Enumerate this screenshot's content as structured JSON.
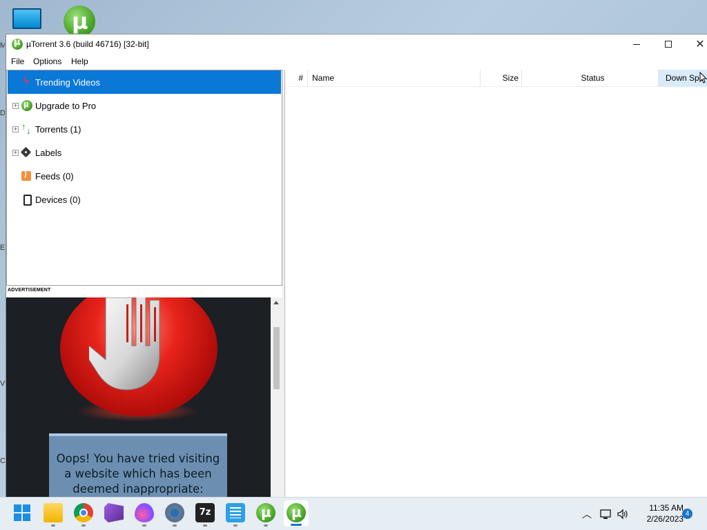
{
  "window": {
    "title": "µTorrent 3.6  (build 46716) [32-bit]",
    "controls": {
      "minimize": "",
      "maximize": "",
      "close": "✕"
    }
  },
  "menu": [
    "File",
    "Options",
    "Help"
  ],
  "sidebar": {
    "items": [
      {
        "label": "Trending Videos",
        "icon": "trending-icon",
        "expandable": false,
        "selected": true
      },
      {
        "label": "Upgrade to Pro",
        "icon": "utorrent-icon",
        "expandable": true,
        "selected": false
      },
      {
        "label": "Torrents (1)",
        "icon": "torrents-icon",
        "expandable": true,
        "selected": false
      },
      {
        "label": "Labels",
        "icon": "label-tag-icon",
        "expandable": true,
        "selected": false
      },
      {
        "label": "Feeds (0)",
        "icon": "rss-feed-icon",
        "expandable": false,
        "selected": false
      },
      {
        "label": "Devices (0)",
        "icon": "device-icon",
        "expandable": false,
        "selected": false
      }
    ],
    "selected_color": "#0a78d7"
  },
  "advertisement": {
    "label": "ADVERTISEMENT",
    "message_lines": [
      "Oops! You have tried visiting",
      "a website which has been",
      "deemed inappropriate:"
    ]
  },
  "torrent_list": {
    "columns": [
      "#",
      "Name",
      "Size",
      "Status",
      "Down Spe"
    ],
    "rows": []
  },
  "taskbar": {
    "apps": [
      "start-icon",
      "file-explorer-icon",
      "chrome-icon",
      "visual-studio-icon",
      "paint-drop-icon",
      "settings-gear-icon",
      "7zip-icon",
      "notepad-icon",
      "utorrent-icon",
      "utorrent-active-icon"
    ],
    "time": "11:35 AM",
    "date": "2/26/2023",
    "notification_count": "4"
  }
}
